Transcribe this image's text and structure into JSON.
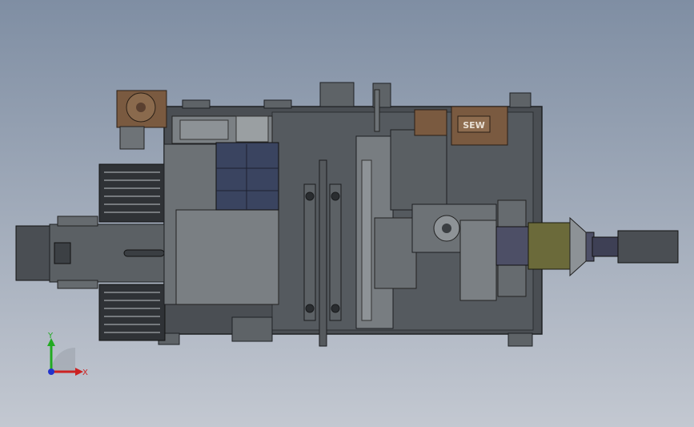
{
  "viewport": {
    "background_top": "#7f8ea3",
    "background_bottom": "#c3c8d1"
  },
  "model": {
    "motor_brand": "SEW",
    "colors": {
      "frame": "#4a4e53",
      "frame_dark": "#2f3236",
      "steel": "#6e7377",
      "steel_light": "#9a9fa2",
      "motor_brown": "#7a5a40",
      "blue_block": "#3a4460",
      "olive": "#6b6a3a",
      "purple_steel": "#4d4f66"
    }
  },
  "triad": {
    "y_label": "Y",
    "x_label": "X",
    "y_color": "#22aa22",
    "x_color": "#cc2222",
    "z_color": "#2233cc"
  }
}
